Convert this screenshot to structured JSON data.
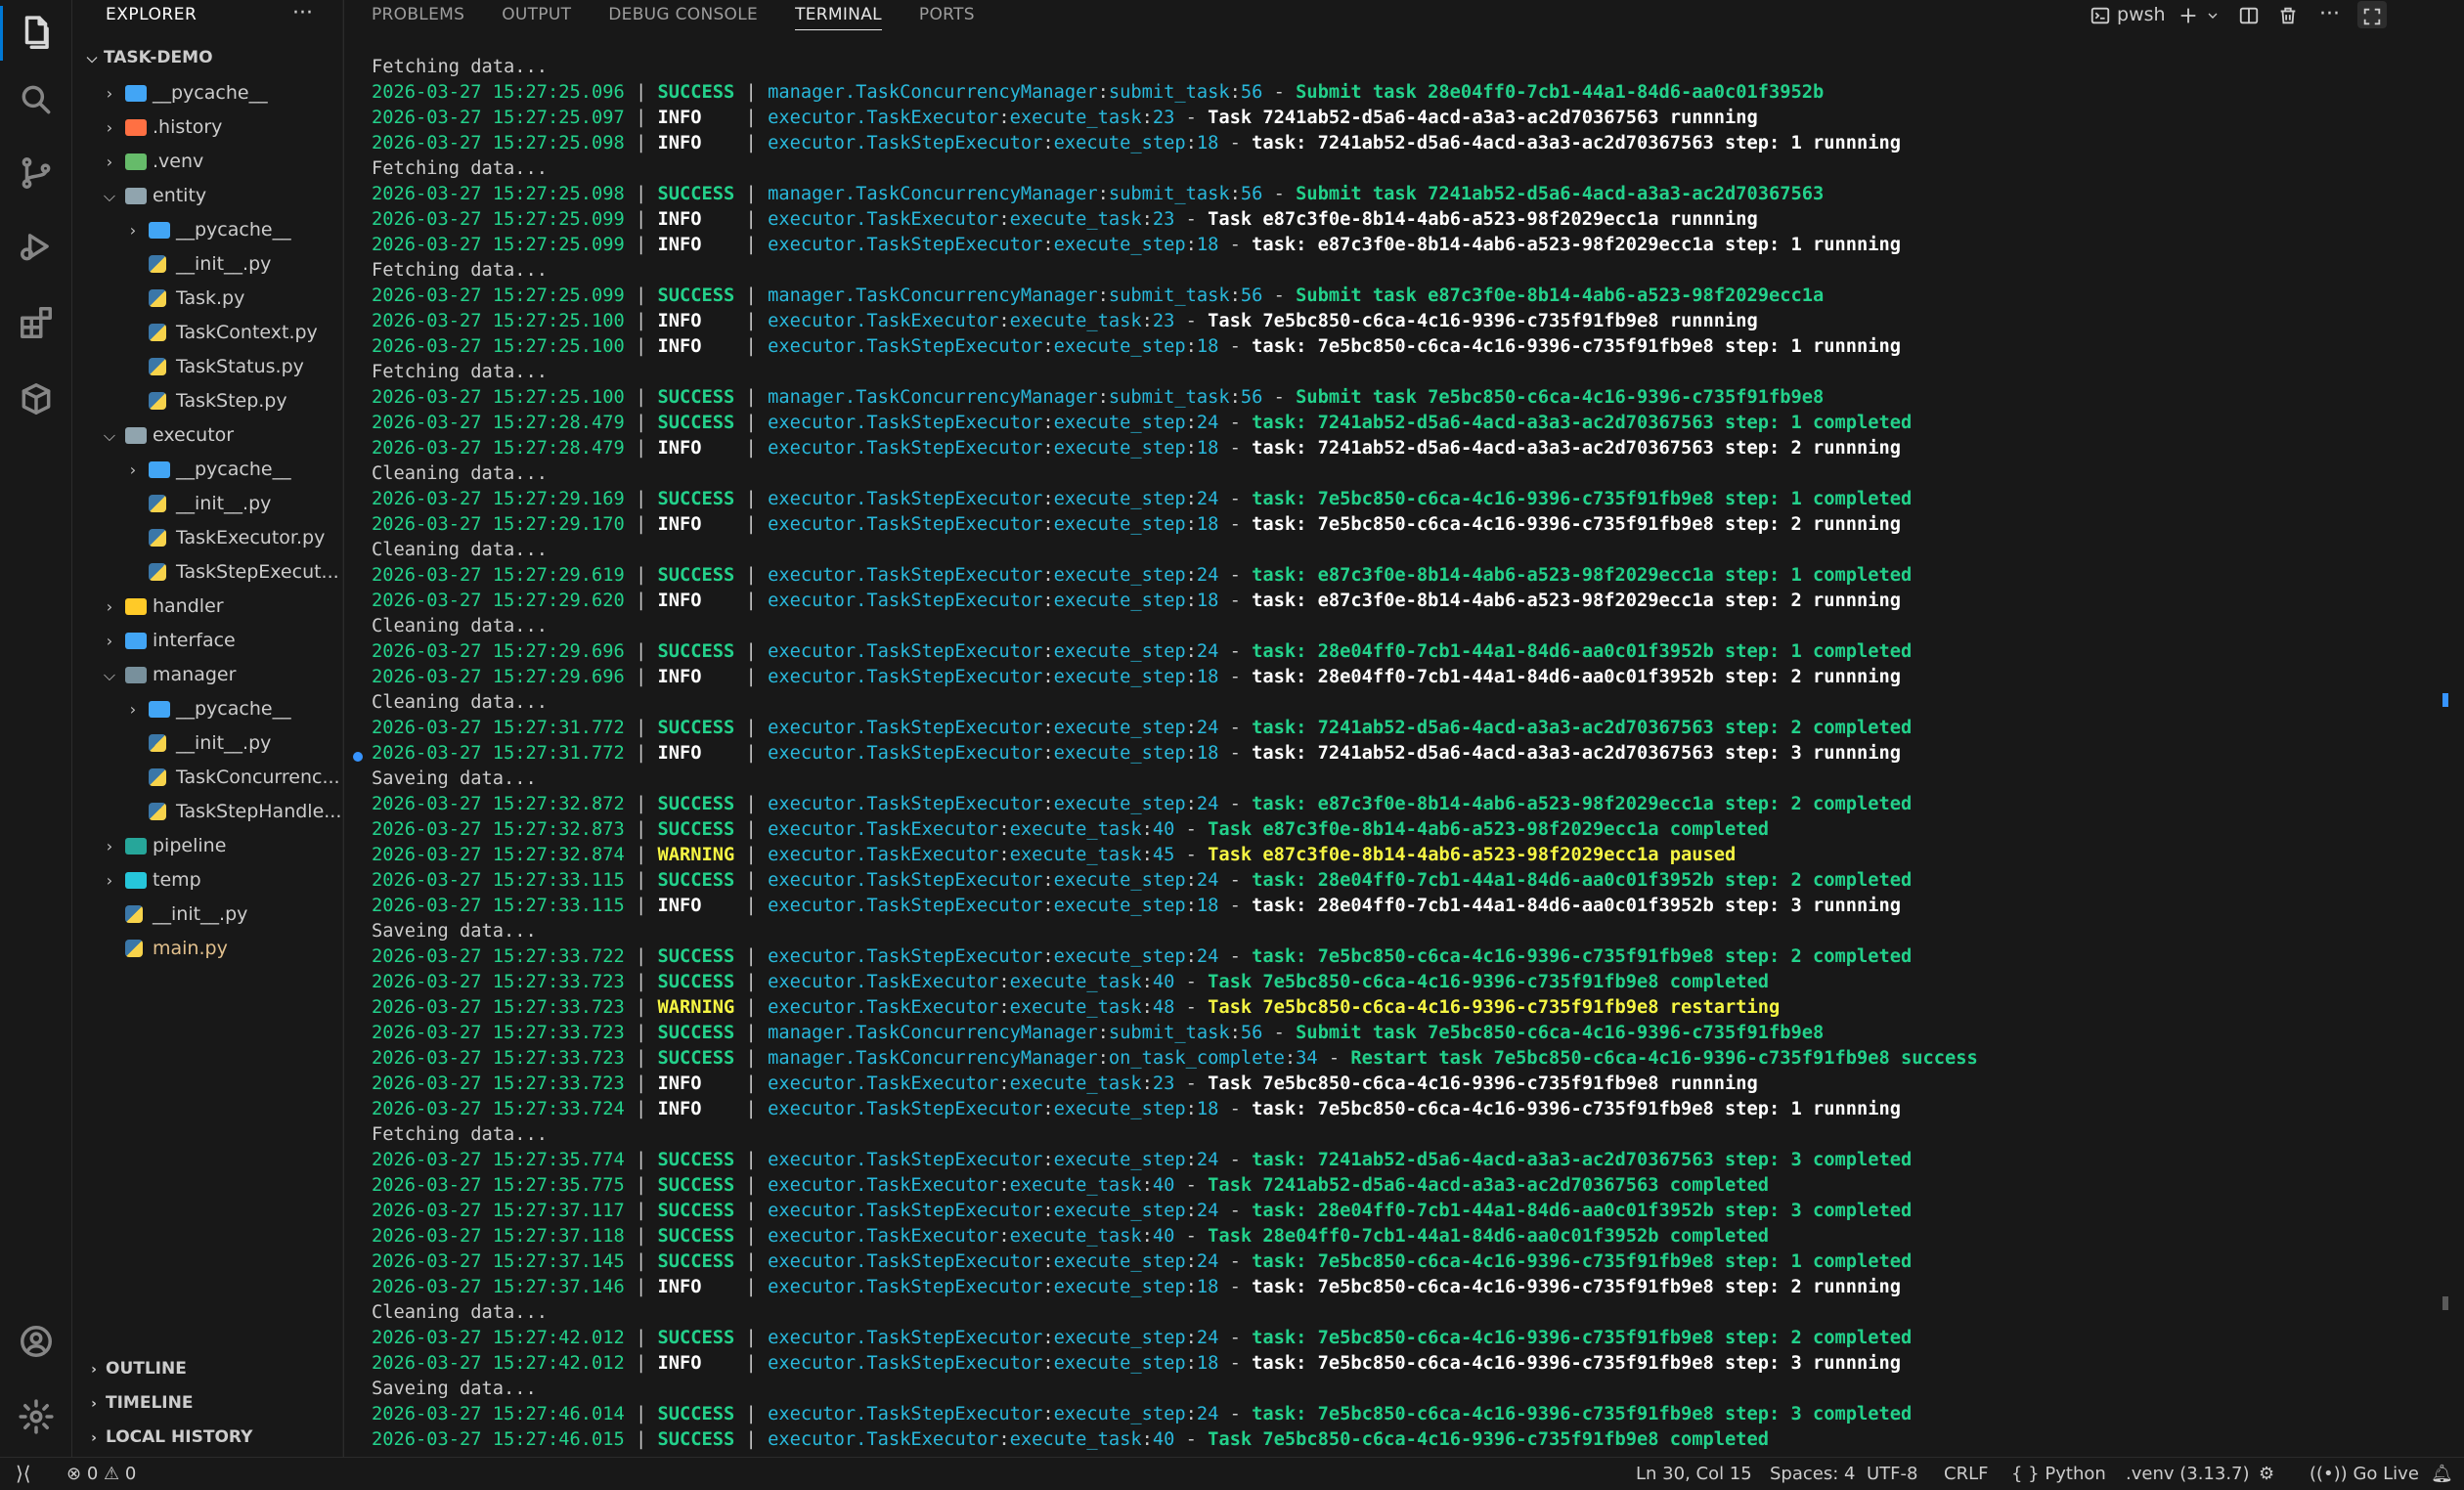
{
  "sidebar": {
    "title": "EXPLORER",
    "more": "···",
    "workspace": "TASK-DEMO",
    "tree": [
      {
        "label": "__pycache__",
        "indent": 1,
        "type": "folder",
        "state": "collapsed",
        "color": "#42a5f5"
      },
      {
        "label": ".history",
        "indent": 1,
        "type": "folder",
        "state": "collapsed",
        "color": "#ff7043"
      },
      {
        "label": ".venv",
        "indent": 1,
        "type": "folder",
        "state": "collapsed",
        "color": "#66bb6a"
      },
      {
        "label": "entity",
        "indent": 1,
        "type": "folder",
        "state": "expanded",
        "color": "#90a4ae"
      },
      {
        "label": "__pycache__",
        "indent": 2,
        "type": "folder",
        "state": "collapsed",
        "color": "#42a5f5"
      },
      {
        "label": "__init__.py",
        "indent": 2,
        "type": "py"
      },
      {
        "label": "Task.py",
        "indent": 2,
        "type": "py"
      },
      {
        "label": "TaskContext.py",
        "indent": 2,
        "type": "py"
      },
      {
        "label": "TaskStatus.py",
        "indent": 2,
        "type": "py"
      },
      {
        "label": "TaskStep.py",
        "indent": 2,
        "type": "py"
      },
      {
        "label": "executor",
        "indent": 1,
        "type": "folder",
        "state": "expanded",
        "color": "#90a4ae"
      },
      {
        "label": "__pycache__",
        "indent": 2,
        "type": "folder",
        "state": "collapsed",
        "color": "#42a5f5"
      },
      {
        "label": "__init__.py",
        "indent": 2,
        "type": "py"
      },
      {
        "label": "TaskExecutor.py",
        "indent": 2,
        "type": "py"
      },
      {
        "label": "TaskStepExecut...",
        "indent": 2,
        "type": "py"
      },
      {
        "label": "handler",
        "indent": 1,
        "type": "folder",
        "state": "collapsed",
        "color": "#ffca28"
      },
      {
        "label": "interface",
        "indent": 1,
        "type": "folder",
        "state": "collapsed",
        "color": "#42a5f5"
      },
      {
        "label": "manager",
        "indent": 1,
        "type": "folder",
        "state": "expanded",
        "color": "#78909c"
      },
      {
        "label": "__pycache__",
        "indent": 2,
        "type": "folder",
        "state": "collapsed",
        "color": "#42a5f5"
      },
      {
        "label": "__init__.py",
        "indent": 2,
        "type": "py"
      },
      {
        "label": "TaskConcurrenc...",
        "indent": 2,
        "type": "py"
      },
      {
        "label": "TaskStepHandle...",
        "indent": 2,
        "type": "py"
      },
      {
        "label": "pipeline",
        "indent": 1,
        "type": "folder",
        "state": "collapsed",
        "color": "#26a69a"
      },
      {
        "label": "temp",
        "indent": 1,
        "type": "folder",
        "state": "collapsed",
        "color": "#26c6da"
      },
      {
        "label": "__init__.py",
        "indent": 1,
        "type": "py"
      },
      {
        "label": "main.py",
        "indent": 1,
        "type": "py",
        "highlight": true
      }
    ],
    "sections": [
      "OUTLINE",
      "TIMELINE",
      "LOCAL HISTORY"
    ]
  },
  "panel": {
    "tabs": [
      {
        "label": "PROBLEMS",
        "active": false
      },
      {
        "label": "OUTPUT",
        "active": false
      },
      {
        "label": "DEBUG CONSOLE",
        "active": false
      },
      {
        "label": "TERMINAL",
        "active": true
      },
      {
        "label": "PORTS",
        "active": false
      }
    ],
    "shell": "pwsh",
    "log": [
      {
        "plain": "Fetching data..."
      },
      {
        "ts": "2026-03-27 15:27:25.096",
        "level": "SUCCESS",
        "mod": "manager.TaskConcurrencyManager",
        "fn": "submit_task",
        "line": "56",
        "msg": "Submit task 28e04ff0-7cb1-44a1-84d6-aa0c01f3952b"
      },
      {
        "ts": "2026-03-27 15:27:25.097",
        "level": "INFO",
        "mod": "executor.TaskExecutor",
        "fn": "execute_task",
        "line": "23",
        "msg": "Task 7241ab52-d5a6-4acd-a3a3-ac2d70367563 runnning"
      },
      {
        "ts": "2026-03-27 15:27:25.098",
        "level": "INFO",
        "mod": "executor.TaskStepExecutor",
        "fn": "execute_step",
        "line": "18",
        "msg": "task: 7241ab52-d5a6-4acd-a3a3-ac2d70367563 step: 1 runnning"
      },
      {
        "plain": "Fetching data..."
      },
      {
        "ts": "2026-03-27 15:27:25.098",
        "level": "SUCCESS",
        "mod": "manager.TaskConcurrencyManager",
        "fn": "submit_task",
        "line": "56",
        "msg": "Submit task 7241ab52-d5a6-4acd-a3a3-ac2d70367563"
      },
      {
        "ts": "2026-03-27 15:27:25.099",
        "level": "INFO",
        "mod": "executor.TaskExecutor",
        "fn": "execute_task",
        "line": "23",
        "msg": "Task e87c3f0e-8b14-4ab6-a523-98f2029ecc1a runnning"
      },
      {
        "ts": "2026-03-27 15:27:25.099",
        "level": "INFO",
        "mod": "executor.TaskStepExecutor",
        "fn": "execute_step",
        "line": "18",
        "msg": "task: e87c3f0e-8b14-4ab6-a523-98f2029ecc1a step: 1 runnning"
      },
      {
        "plain": "Fetching data..."
      },
      {
        "ts": "2026-03-27 15:27:25.099",
        "level": "SUCCESS",
        "mod": "manager.TaskConcurrencyManager",
        "fn": "submit_task",
        "line": "56",
        "msg": "Submit task e87c3f0e-8b14-4ab6-a523-98f2029ecc1a"
      },
      {
        "ts": "2026-03-27 15:27:25.100",
        "level": "INFO",
        "mod": "executor.TaskExecutor",
        "fn": "execute_task",
        "line": "23",
        "msg": "Task 7e5bc850-c6ca-4c16-9396-c735f91fb9e8 runnning"
      },
      {
        "ts": "2026-03-27 15:27:25.100",
        "level": "INFO",
        "mod": "executor.TaskStepExecutor",
        "fn": "execute_step",
        "line": "18",
        "msg": "task: 7e5bc850-c6ca-4c16-9396-c735f91fb9e8 step: 1 runnning"
      },
      {
        "plain": "Fetching data..."
      },
      {
        "ts": "2026-03-27 15:27:25.100",
        "level": "SUCCESS",
        "mod": "manager.TaskConcurrencyManager",
        "fn": "submit_task",
        "line": "56",
        "msg": "Submit task 7e5bc850-c6ca-4c16-9396-c735f91fb9e8"
      },
      {
        "ts": "2026-03-27 15:27:28.479",
        "level": "SUCCESS",
        "mod": "executor.TaskStepExecutor",
        "fn": "execute_step",
        "line": "24",
        "msg": "task: 7241ab52-d5a6-4acd-a3a3-ac2d70367563 step: 1 completed"
      },
      {
        "ts": "2026-03-27 15:27:28.479",
        "level": "INFO",
        "mod": "executor.TaskStepExecutor",
        "fn": "execute_step",
        "line": "18",
        "msg": "task: 7241ab52-d5a6-4acd-a3a3-ac2d70367563 step: 2 runnning"
      },
      {
        "plain": "Cleaning data..."
      },
      {
        "ts": "2026-03-27 15:27:29.169",
        "level": "SUCCESS",
        "mod": "executor.TaskStepExecutor",
        "fn": "execute_step",
        "line": "24",
        "msg": "task: 7e5bc850-c6ca-4c16-9396-c735f91fb9e8 step: 1 completed"
      },
      {
        "ts": "2026-03-27 15:27:29.170",
        "level": "INFO",
        "mod": "executor.TaskStepExecutor",
        "fn": "execute_step",
        "line": "18",
        "msg": "task: 7e5bc850-c6ca-4c16-9396-c735f91fb9e8 step: 2 runnning"
      },
      {
        "plain": "Cleaning data..."
      },
      {
        "ts": "2026-03-27 15:27:29.619",
        "level": "SUCCESS",
        "mod": "executor.TaskStepExecutor",
        "fn": "execute_step",
        "line": "24",
        "msg": "task: e87c3f0e-8b14-4ab6-a523-98f2029ecc1a step: 1 completed"
      },
      {
        "ts": "2026-03-27 15:27:29.620",
        "level": "INFO",
        "mod": "executor.TaskStepExecutor",
        "fn": "execute_step",
        "line": "18",
        "msg": "task: e87c3f0e-8b14-4ab6-a523-98f2029ecc1a step: 2 runnning"
      },
      {
        "plain": "Cleaning data..."
      },
      {
        "ts": "2026-03-27 15:27:29.696",
        "level": "SUCCESS",
        "mod": "executor.TaskStepExecutor",
        "fn": "execute_step",
        "line": "24",
        "msg": "task: 28e04ff0-7cb1-44a1-84d6-aa0c01f3952b step: 1 completed"
      },
      {
        "ts": "2026-03-27 15:27:29.696",
        "level": "INFO",
        "mod": "executor.TaskStepExecutor",
        "fn": "execute_step",
        "line": "18",
        "msg": "task: 28e04ff0-7cb1-44a1-84d6-aa0c01f3952b step: 2 runnning"
      },
      {
        "plain": "Cleaning data..."
      },
      {
        "ts": "2026-03-27 15:27:31.772",
        "level": "SUCCESS",
        "mod": "executor.TaskStepExecutor",
        "fn": "execute_step",
        "line": "24",
        "msg": "task: 7241ab52-d5a6-4acd-a3a3-ac2d70367563 step: 2 completed"
      },
      {
        "ts": "2026-03-27 15:27:31.772",
        "level": "INFO",
        "mod": "executor.TaskStepExecutor",
        "fn": "execute_step",
        "line": "18",
        "msg": "task: 7241ab52-d5a6-4acd-a3a3-ac2d70367563 step: 3 runnning"
      },
      {
        "plain": "Saveing data..."
      },
      {
        "ts": "2026-03-27 15:27:32.872",
        "level": "SUCCESS",
        "mod": "executor.TaskStepExecutor",
        "fn": "execute_step",
        "line": "24",
        "msg": "task: e87c3f0e-8b14-4ab6-a523-98f2029ecc1a step: 2 completed"
      },
      {
        "ts": "2026-03-27 15:27:32.873",
        "level": "SUCCESS",
        "mod": "executor.TaskExecutor",
        "fn": "execute_task",
        "line": "40",
        "msg": "Task e87c3f0e-8b14-4ab6-a523-98f2029ecc1a completed"
      },
      {
        "ts": "2026-03-27 15:27:32.874",
        "level": "WARNING",
        "mod": "executor.TaskExecutor",
        "fn": "execute_task",
        "line": "45",
        "msg": "Task e87c3f0e-8b14-4ab6-a523-98f2029ecc1a paused"
      },
      {
        "ts": "2026-03-27 15:27:33.115",
        "level": "SUCCESS",
        "mod": "executor.TaskStepExecutor",
        "fn": "execute_step",
        "line": "24",
        "msg": "task: 28e04ff0-7cb1-44a1-84d6-aa0c01f3952b step: 2 completed"
      },
      {
        "ts": "2026-03-27 15:27:33.115",
        "level": "INFO",
        "mod": "executor.TaskStepExecutor",
        "fn": "execute_step",
        "line": "18",
        "msg": "task: 28e04ff0-7cb1-44a1-84d6-aa0c01f3952b step: 3 runnning"
      },
      {
        "plain": "Saveing data..."
      },
      {
        "ts": "2026-03-27 15:27:33.722",
        "level": "SUCCESS",
        "mod": "executor.TaskStepExecutor",
        "fn": "execute_step",
        "line": "24",
        "msg": "task: 7e5bc850-c6ca-4c16-9396-c735f91fb9e8 step: 2 completed"
      },
      {
        "ts": "2026-03-27 15:27:33.723",
        "level": "SUCCESS",
        "mod": "executor.TaskExecutor",
        "fn": "execute_task",
        "line": "40",
        "msg": "Task 7e5bc850-c6ca-4c16-9396-c735f91fb9e8 completed"
      },
      {
        "ts": "2026-03-27 15:27:33.723",
        "level": "WARNING",
        "mod": "executor.TaskExecutor",
        "fn": "execute_task",
        "line": "48",
        "msg": "Task 7e5bc850-c6ca-4c16-9396-c735f91fb9e8 restarting"
      },
      {
        "ts": "2026-03-27 15:27:33.723",
        "level": "SUCCESS",
        "mod": "manager.TaskConcurrencyManager",
        "fn": "submit_task",
        "line": "56",
        "msg": "Submit task 7e5bc850-c6ca-4c16-9396-c735f91fb9e8"
      },
      {
        "ts": "2026-03-27 15:27:33.723",
        "level": "SUCCESS",
        "mod": "manager.TaskConcurrencyManager",
        "fn": "on_task_complete",
        "line": "34",
        "msg": "Restart task 7e5bc850-c6ca-4c16-9396-c735f91fb9e8 success"
      },
      {
        "ts": "2026-03-27 15:27:33.723",
        "level": "INFO",
        "mod": "executor.TaskExecutor",
        "fn": "execute_task",
        "line": "23",
        "msg": "Task 7e5bc850-c6ca-4c16-9396-c735f91fb9e8 runnning"
      },
      {
        "ts": "2026-03-27 15:27:33.724",
        "level": "INFO",
        "mod": "executor.TaskStepExecutor",
        "fn": "execute_step",
        "line": "18",
        "msg": "task: 7e5bc850-c6ca-4c16-9396-c735f91fb9e8 step: 1 runnning"
      },
      {
        "plain": "Fetching data..."
      },
      {
        "ts": "2026-03-27 15:27:35.774",
        "level": "SUCCESS",
        "mod": "executor.TaskStepExecutor",
        "fn": "execute_step",
        "line": "24",
        "msg": "task: 7241ab52-d5a6-4acd-a3a3-ac2d70367563 step: 3 completed"
      },
      {
        "ts": "2026-03-27 15:27:35.775",
        "level": "SUCCESS",
        "mod": "executor.TaskExecutor",
        "fn": "execute_task",
        "line": "40",
        "msg": "Task 7241ab52-d5a6-4acd-a3a3-ac2d70367563 completed"
      },
      {
        "ts": "2026-03-27 15:27:37.117",
        "level": "SUCCESS",
        "mod": "executor.TaskStepExecutor",
        "fn": "execute_step",
        "line": "24",
        "msg": "task: 28e04ff0-7cb1-44a1-84d6-aa0c01f3952b step: 3 completed"
      },
      {
        "ts": "2026-03-27 15:27:37.118",
        "level": "SUCCESS",
        "mod": "executor.TaskExecutor",
        "fn": "execute_task",
        "line": "40",
        "msg": "Task 28e04ff0-7cb1-44a1-84d6-aa0c01f3952b completed"
      },
      {
        "ts": "2026-03-27 15:27:37.145",
        "level": "SUCCESS",
        "mod": "executor.TaskStepExecutor",
        "fn": "execute_step",
        "line": "24",
        "msg": "task: 7e5bc850-c6ca-4c16-9396-c735f91fb9e8 step: 1 completed"
      },
      {
        "ts": "2026-03-27 15:27:37.146",
        "level": "INFO",
        "mod": "executor.TaskStepExecutor",
        "fn": "execute_step",
        "line": "18",
        "msg": "task: 7e5bc850-c6ca-4c16-9396-c735f91fb9e8 step: 2 runnning"
      },
      {
        "plain": "Cleaning data..."
      },
      {
        "ts": "2026-03-27 15:27:42.012",
        "level": "SUCCESS",
        "mod": "executor.TaskStepExecutor",
        "fn": "execute_step",
        "line": "24",
        "msg": "task: 7e5bc850-c6ca-4c16-9396-c735f91fb9e8 step: 2 completed"
      },
      {
        "ts": "2026-03-27 15:27:42.012",
        "level": "INFO",
        "mod": "executor.TaskStepExecutor",
        "fn": "execute_step",
        "line": "18",
        "msg": "task: 7e5bc850-c6ca-4c16-9396-c735f91fb9e8 step: 3 runnning"
      },
      {
        "plain": "Saveing data..."
      },
      {
        "ts": "2026-03-27 15:27:46.014",
        "level": "SUCCESS",
        "mod": "executor.TaskStepExecutor",
        "fn": "execute_step",
        "line": "24",
        "msg": "task: 7e5bc850-c6ca-4c16-9396-c735f91fb9e8 step: 3 completed"
      },
      {
        "ts": "2026-03-27 15:27:46.015",
        "level": "SUCCESS",
        "mod": "executor.TaskExecutor",
        "fn": "execute_task",
        "line": "40",
        "msg": "Task 7e5bc850-c6ca-4c16-9396-c735f91fb9e8 completed"
      }
    ]
  },
  "status": {
    "errors": "0",
    "warnings": "0",
    "position": "Ln 30, Col 15",
    "spaces": "Spaces: 4",
    "encoding": "UTF-8",
    "eol": "CRLF",
    "language_icon": "{ }",
    "language": "Python",
    "interpreter": ".venv (3.13.7)",
    "golive": "Go Live"
  },
  "colors": {
    "accent": "#0078d4",
    "success": "#23d18b",
    "info": "#ffffff",
    "warning": "#f5f543",
    "source": "#29b8db"
  }
}
